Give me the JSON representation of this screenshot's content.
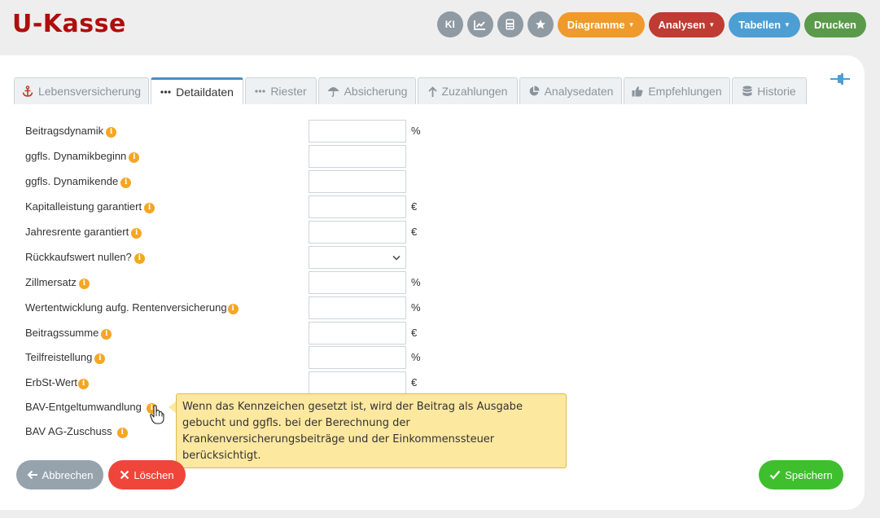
{
  "app": {
    "title": "U-Kasse"
  },
  "toolbar": {
    "ki_label": "KI",
    "diagramme_label": "Diagramme",
    "analysen_label": "Analysen",
    "tabellen_label": "Tabellen",
    "drucken_label": "Drucken",
    "colors": {
      "circle": "#8f9aa3",
      "diagramme": "#ef9a2b",
      "analysen": "#bf3b33",
      "tabellen": "#4d9ed3",
      "drucken": "#5a9a4a"
    }
  },
  "tabs": [
    {
      "label": "Lebensversicherung",
      "icon": "anchor-icon",
      "active": false
    },
    {
      "label": "Detaildaten",
      "icon": "ellipsis-icon",
      "active": true
    },
    {
      "label": "Riester",
      "icon": "ellipsis-icon",
      "active": false
    },
    {
      "label": "Absicherung",
      "icon": "umbrella-icon",
      "active": false
    },
    {
      "label": "Zuzahlungen",
      "icon": "arrow-up-icon",
      "active": false
    },
    {
      "label": "Analysedaten",
      "icon": "pie-chart-icon",
      "active": false
    },
    {
      "label": "Empfehlungen",
      "icon": "thumbs-up-icon",
      "active": false
    },
    {
      "label": "Historie",
      "icon": "database-icon",
      "active": false
    }
  ],
  "form": {
    "fields": [
      {
        "label": "Beitragsdynamik",
        "value": "",
        "unit": "%"
      },
      {
        "label": "ggfls. Dynamikbeginn",
        "value": "",
        "unit": ""
      },
      {
        "label": "ggfls. Dynamikende",
        "value": "",
        "unit": ""
      },
      {
        "label": "Kapitalleistung garantiert",
        "value": "",
        "unit": "€"
      },
      {
        "label": "Jahresrente garantiert",
        "value": "",
        "unit": "€"
      },
      {
        "label": "Rückkaufswert nullen?",
        "value": "",
        "unit": ""
      },
      {
        "label": "Zillmersatz",
        "value": "",
        "unit": "%"
      },
      {
        "label": "Wertentwicklung aufg. Rentenversicherung",
        "value": "",
        "unit": "%"
      },
      {
        "label": "Beitragssumme",
        "value": "",
        "unit": "€"
      },
      {
        "label": "Teilfreistellung",
        "value": "",
        "unit": "%"
      },
      {
        "label": "ErbSt-Wert",
        "value": "",
        "unit": "€"
      },
      {
        "label": "BAV-Entgeltumwandlung",
        "value": "",
        "unit": ""
      },
      {
        "label": "BAV AG-Zuschuss",
        "value": "",
        "unit": ""
      }
    ],
    "info_glyph": "i"
  },
  "tooltip": {
    "text": "Wenn das Kennzeichen gesetzt ist, wird der Beitrag als Ausgabe gebucht und ggfls. bei der Berechnung der Krankenversicherungsbeiträge und der Einkommenssteuer berücksichtigt."
  },
  "footer": {
    "abbrechen_label": "Abbrechen",
    "loeschen_label": "Löschen",
    "speichern_label": "Speichern",
    "colors": {
      "abbrechen": "#96a2ac",
      "loeschen": "#f0453a",
      "speichern": "#3fbf2e"
    }
  }
}
